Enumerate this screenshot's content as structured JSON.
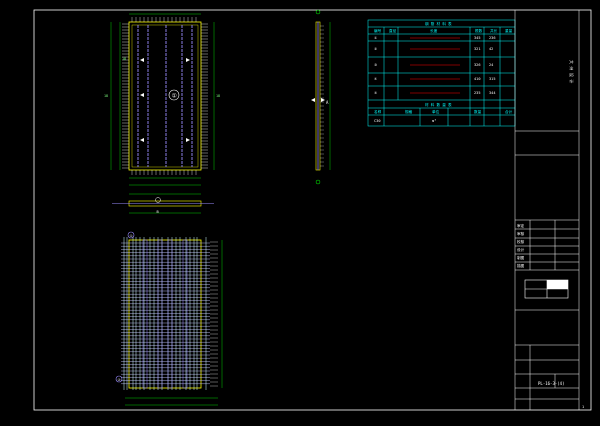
{
  "drawing": {
    "background": "#000000",
    "frame_color": "#ffffff",
    "rebar_color": "#9a8cff",
    "concrete_color": "#ffff00",
    "dimension_color": "#00ff00",
    "table_color": "#00ffff",
    "bar_red": "#ff0000"
  },
  "top_view": {
    "section_marker": "①",
    "left_dims": [
      "18",
      "18"
    ],
    "right_dims": [
      "18"
    ]
  },
  "side_view": {
    "marker": "A"
  },
  "small_section": {
    "marker": "B"
  },
  "bottom_view": {
    "markers": [
      "①",
      "②"
    ]
  },
  "rebar_table": {
    "title": "钢 筋 材 料 表",
    "header": [
      "编号",
      "直径",
      "长度",
      "根数",
      "共长",
      "重量"
    ],
    "rows": [
      {
        "no": "①",
        "len": "345",
        "cnt": "236"
      },
      {
        "no": "②",
        "len": "321",
        "cnt": "42"
      },
      {
        "no": "③",
        "len": "326",
        "cnt": "24"
      },
      {
        "no": "④",
        "len": "410",
        "cnt": "315"
      },
      {
        "no": "⑤",
        "len": "235",
        "cnt": "344"
      }
    ],
    "sub_title": "材 料 数 量 表",
    "sub_header": [
      "名称",
      "规格",
      "单位",
      "数量",
      "合计"
    ],
    "sub_row": [
      "C30",
      "",
      "m³",
      "",
      ""
    ]
  },
  "title_block": {
    "company": "大 州 设 计",
    "rows": [
      "审定",
      "审核",
      "校核",
      "设计",
      "制图",
      "描图"
    ],
    "sheet_code": "PL-16-3-(4)",
    "page_no": "1"
  }
}
